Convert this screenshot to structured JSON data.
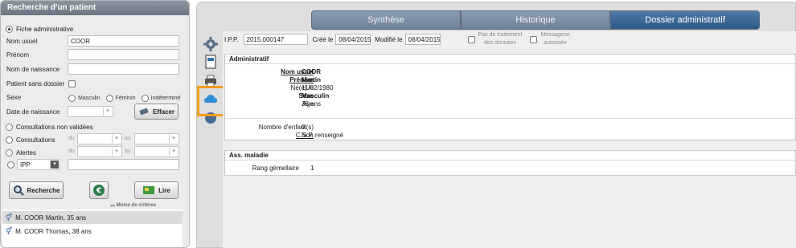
{
  "left": {
    "title": "Recherche d'un patient",
    "fiche_label": "Fiche administrative",
    "nom_usuel_label": "Nom usuel",
    "nom_usuel_value": "COOR",
    "prenom_label": "Prénom",
    "nom_naissance_label": "Nom de naissance",
    "sans_dossier_label": "Patient sans dossier",
    "sexe_label": "Sexe",
    "sexe_options": [
      "Masculin",
      "Féminin",
      "Indéterminé"
    ],
    "date_naissance_label": "Date de naissance",
    "effacer_label": "Effacer",
    "consult_non_validees_label": "Consultations non validées",
    "consultations_label": "Consultations",
    "alertes_label": "Alertes",
    "du_label": "du",
    "au_label": "au",
    "ipp_select": "IPP",
    "recherche_label": "Recherche",
    "lire_label": "Lire",
    "moins_criteres_label": "Moins de critères",
    "results": [
      "M. COOR Martin, 35 ans",
      "M. COOR Thomas, 38 ans"
    ]
  },
  "tabs": [
    "Synthèse",
    "Historique",
    "Dossier administratif"
  ],
  "header": {
    "ipp_label": "I.P.P.",
    "ipp_value": "2015.000147",
    "cree_label": "Créé le",
    "cree_value": "08/04/2015",
    "modifie_label": "Modifié le",
    "modifie_value": "08/04/2015",
    "pas_traitement_label_1": "Pas de traitement",
    "pas_traitement_label_2": "des données",
    "messagerie_label_1": "Messagerie",
    "messagerie_label_2": "autorisée"
  },
  "administratif": {
    "title": "Administratif",
    "nom_usuel_label": "Nom usuel",
    "nom_usuel_value": "COOR",
    "prenom_label": "Prénom",
    "prenom_value": "Martin",
    "nee_label": "Né(e) le",
    "nee_value": "11/02/1980",
    "sexe_label": "Sexe",
    "sexe_value": "Masculin",
    "age_label": "Age",
    "age_value": "35 ans",
    "enfants_label": "Nombre d'enfant(s)",
    "enfants_value": "0",
    "csp_label": "C.S.P.",
    "csp_value": "Non renseigné"
  },
  "ass_maladie": {
    "title": "Ass. maladie",
    "rang_label": "Rang gémellaire",
    "rang_value": "1"
  },
  "colors": {
    "accent_tab": "#3a6494",
    "highlight": "#f29f1b",
    "selected_row": "#dbdbdb"
  }
}
